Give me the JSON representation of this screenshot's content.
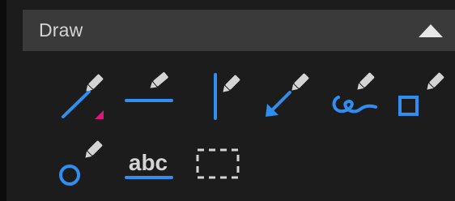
{
  "panel": {
    "title": "Draw",
    "collapse_icon": "triangle-up-icon"
  },
  "tools": [
    {
      "name": "line-tool",
      "icon": "pen-line-icon"
    },
    {
      "name": "horizontal-line-tool",
      "icon": "pen-horizontal-line-icon"
    },
    {
      "name": "vertical-line-tool",
      "icon": "pen-vertical-line-icon"
    },
    {
      "name": "arrow-tool",
      "icon": "pen-arrow-icon"
    },
    {
      "name": "freehand-tool",
      "icon": "pen-freehand-icon"
    },
    {
      "name": "rectangle-tool",
      "icon": "pen-rectangle-icon"
    },
    {
      "name": "circle-tool",
      "icon": "pen-circle-icon"
    },
    {
      "name": "text-tool",
      "icon": "abc-text-icon",
      "label": "abc"
    },
    {
      "name": "selection-tool",
      "icon": "dashed-rectangle-icon"
    }
  ],
  "colors": {
    "accent_blue": "#2f8ff0",
    "pen_gray": "#d4d4d4",
    "magenta_marker": "#e0157d",
    "header_bg": "#3a3a3a",
    "panel_bg": "#1c1c1c"
  }
}
